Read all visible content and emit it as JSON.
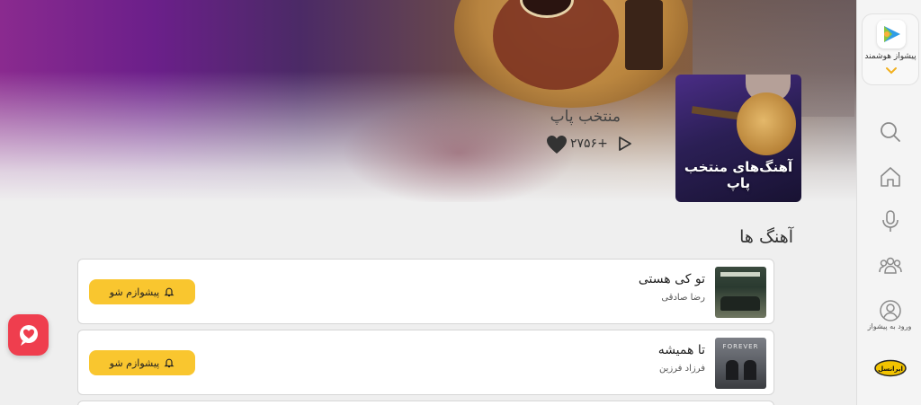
{
  "playlist": {
    "cover_title": "آهنگ‌های منتخب پاپ",
    "title": "منتخب پاپ",
    "likes": "+۲۷۵۶"
  },
  "songs_section": {
    "title": "آهنگ ها",
    "items": [
      {
        "title": "تو کی هستی",
        "artist": "رضا صادقی",
        "action_label": "پیشوازم شو",
        "thumb_text": "WHO ARE YOU"
      },
      {
        "title": "تا همیشه",
        "artist": "فرزاد فرزین",
        "action_label": "پیشوازم شو",
        "thumb_text": "FOREVER"
      }
    ]
  },
  "sidebar": {
    "brand_name": "پیشواز هوشمند",
    "login_label": "ورود به پیشواز",
    "operator_name": "ایرانسل",
    "icons": [
      "search-icon",
      "home-icon",
      "microphone-icon",
      "group-icon",
      "user-icon"
    ]
  },
  "colors": {
    "accent_yellow": "#f9c62f",
    "chat_red": "#ef3e4e",
    "background": "#efefef"
  }
}
